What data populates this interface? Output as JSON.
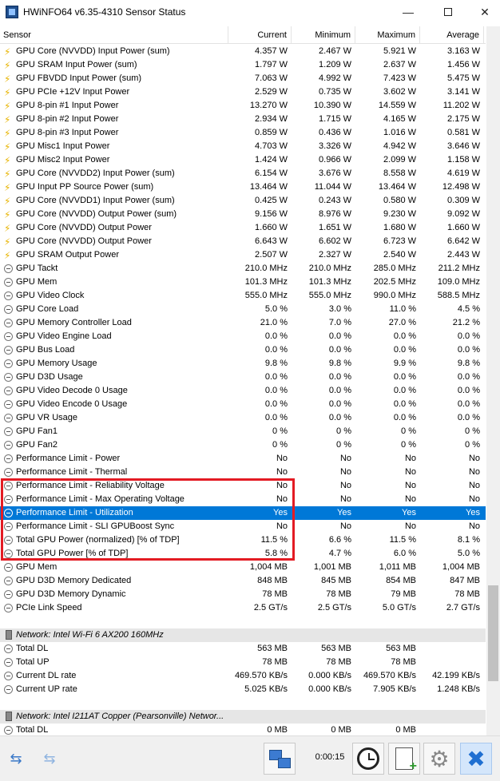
{
  "window": {
    "title": "HWiNFO64 v6.35-4310 Sensor Status",
    "min_glyph": "—",
    "close_glyph": "✕"
  },
  "columns": {
    "sensor": "Sensor",
    "current": "Current",
    "minimum": "Minimum",
    "maximum": "Maximum",
    "average": "Average"
  },
  "rows": [
    {
      "icon": "bolt",
      "name": "GPU Core (NVVDD) Input Power (sum)",
      "cur": "4.357 W",
      "min": "2.467 W",
      "max": "5.921 W",
      "avg": "3.163 W"
    },
    {
      "icon": "bolt",
      "name": "GPU SRAM Input Power (sum)",
      "cur": "1.797 W",
      "min": "1.209 W",
      "max": "2.637 W",
      "avg": "1.456 W"
    },
    {
      "icon": "bolt",
      "name": "GPU FBVDD Input Power (sum)",
      "cur": "7.063 W",
      "min": "4.992 W",
      "max": "7.423 W",
      "avg": "5.475 W"
    },
    {
      "icon": "bolt",
      "name": "GPU PCIe +12V Input Power",
      "cur": "2.529 W",
      "min": "0.735 W",
      "max": "3.602 W",
      "avg": "3.141 W"
    },
    {
      "icon": "bolt",
      "name": "GPU 8-pin #1 Input Power",
      "cur": "13.270 W",
      "min": "10.390 W",
      "max": "14.559 W",
      "avg": "11.202 W"
    },
    {
      "icon": "bolt",
      "name": "GPU 8-pin #2 Input Power",
      "cur": "2.934 W",
      "min": "1.715 W",
      "max": "4.165 W",
      "avg": "2.175 W"
    },
    {
      "icon": "bolt",
      "name": "GPU 8-pin #3 Input Power",
      "cur": "0.859 W",
      "min": "0.436 W",
      "max": "1.016 W",
      "avg": "0.581 W"
    },
    {
      "icon": "bolt",
      "name": "GPU Misc1 Input Power",
      "cur": "4.703 W",
      "min": "3.326 W",
      "max": "4.942 W",
      "avg": "3.646 W"
    },
    {
      "icon": "bolt",
      "name": "GPU Misc2 Input Power",
      "cur": "1.424 W",
      "min": "0.966 W",
      "max": "2.099 W",
      "avg": "1.158 W"
    },
    {
      "icon": "bolt",
      "name": "GPU Core (NVVDD2) Input Power (sum)",
      "cur": "6.154 W",
      "min": "3.676 W",
      "max": "8.558 W",
      "avg": "4.619 W"
    },
    {
      "icon": "bolt",
      "name": "GPU Input PP Source Power (sum)",
      "cur": "13.464 W",
      "min": "11.044 W",
      "max": "13.464 W",
      "avg": "12.498 W"
    },
    {
      "icon": "bolt",
      "name": "GPU Core (NVVDD1) Input Power (sum)",
      "cur": "0.425 W",
      "min": "0.243 W",
      "max": "0.580 W",
      "avg": "0.309 W"
    },
    {
      "icon": "bolt",
      "name": "GPU Core (NVVDD) Output Power (sum)",
      "cur": "9.156 W",
      "min": "8.976 W",
      "max": "9.230 W",
      "avg": "9.092 W"
    },
    {
      "icon": "bolt",
      "name": "GPU Core (NVVDD) Output Power",
      "cur": "1.660 W",
      "min": "1.651 W",
      "max": "1.680 W",
      "avg": "1.660 W"
    },
    {
      "icon": "bolt",
      "name": "GPU Core (NVVDD) Output Power",
      "cur": "6.643 W",
      "min": "6.602 W",
      "max": "6.723 W",
      "avg": "6.642 W"
    },
    {
      "icon": "bolt",
      "name": "GPU SRAM Output Power",
      "cur": "2.507 W",
      "min": "2.327 W",
      "max": "2.540 W",
      "avg": "2.443 W"
    },
    {
      "icon": "gauge",
      "name": "GPU Tackt",
      "cur": "210.0 MHz",
      "min": "210.0 MHz",
      "max": "285.0 MHz",
      "avg": "211.2 MHz"
    },
    {
      "icon": "gauge",
      "name": "GPU Mem",
      "cur": "101.3 MHz",
      "min": "101.3 MHz",
      "max": "202.5 MHz",
      "avg": "109.0 MHz"
    },
    {
      "icon": "gauge",
      "name": "GPU Video Clock",
      "cur": "555.0 MHz",
      "min": "555.0 MHz",
      "max": "990.0 MHz",
      "avg": "588.5 MHz"
    },
    {
      "icon": "gauge",
      "name": "GPU Core Load",
      "cur": "5.0 %",
      "min": "3.0 %",
      "max": "11.0 %",
      "avg": "4.5 %"
    },
    {
      "icon": "gauge",
      "name": "GPU Memory Controller Load",
      "cur": "21.0 %",
      "min": "7.0 %",
      "max": "27.0 %",
      "avg": "21.2 %"
    },
    {
      "icon": "gauge",
      "name": "GPU Video Engine Load",
      "cur": "0.0 %",
      "min": "0.0 %",
      "max": "0.0 %",
      "avg": "0.0 %"
    },
    {
      "icon": "gauge",
      "name": "GPU Bus Load",
      "cur": "0.0 %",
      "min": "0.0 %",
      "max": "0.0 %",
      "avg": "0.0 %"
    },
    {
      "icon": "gauge",
      "name": "GPU Memory Usage",
      "cur": "9.8 %",
      "min": "9.8 %",
      "max": "9.9 %",
      "avg": "9.8 %"
    },
    {
      "icon": "gauge",
      "name": "GPU D3D Usage",
      "cur": "0.0 %",
      "min": "0.0 %",
      "max": "0.0 %",
      "avg": "0.0 %"
    },
    {
      "icon": "gauge",
      "name": "GPU Video Decode 0 Usage",
      "cur": "0.0 %",
      "min": "0.0 %",
      "max": "0.0 %",
      "avg": "0.0 %"
    },
    {
      "icon": "gauge",
      "name": "GPU Video Encode 0 Usage",
      "cur": "0.0 %",
      "min": "0.0 %",
      "max": "0.0 %",
      "avg": "0.0 %"
    },
    {
      "icon": "gauge",
      "name": "GPU VR Usage",
      "cur": "0.0 %",
      "min": "0.0 %",
      "max": "0.0 %",
      "avg": "0.0 %"
    },
    {
      "icon": "gauge",
      "name": "GPU Fan1",
      "cur": "0 %",
      "min": "0 %",
      "max": "0 %",
      "avg": "0 %"
    },
    {
      "icon": "gauge",
      "name": "GPU Fan2",
      "cur": "0 %",
      "min": "0 %",
      "max": "0 %",
      "avg": "0 %"
    },
    {
      "icon": "gauge",
      "name": "Performance Limit - Power",
      "cur": "No",
      "min": "No",
      "max": "No",
      "avg": "No"
    },
    {
      "icon": "gauge",
      "name": "Performance Limit - Thermal",
      "cur": "No",
      "min": "No",
      "max": "No",
      "avg": "No"
    },
    {
      "icon": "gauge",
      "name": "Performance Limit - Reliability Voltage",
      "cur": "No",
      "min": "No",
      "max": "No",
      "avg": "No"
    },
    {
      "icon": "gauge",
      "name": "Performance Limit - Max Operating Voltage",
      "cur": "No",
      "min": "No",
      "max": "No",
      "avg": "No"
    },
    {
      "icon": "gauge",
      "name": "Performance Limit - Utilization",
      "cur": "Yes",
      "min": "Yes",
      "max": "Yes",
      "avg": "Yes",
      "selected": true
    },
    {
      "icon": "gauge",
      "name": "Performance Limit - SLI GPUBoost Sync",
      "cur": "No",
      "min": "No",
      "max": "No",
      "avg": "No"
    },
    {
      "icon": "gauge",
      "name": "Total GPU Power (normalized) [% of TDP]",
      "cur": "11.5 %",
      "min": "6.6 %",
      "max": "11.5 %",
      "avg": "8.1 %"
    },
    {
      "icon": "gauge",
      "name": "Total GPU Power [% of TDP]",
      "cur": "5.8 %",
      "min": "4.7 %",
      "max": "6.0 %",
      "avg": "5.0 %"
    },
    {
      "icon": "gauge",
      "name": "GPU Mem",
      "cur": "1,004 MB",
      "min": "1,001 MB",
      "max": "1,011 MB",
      "avg": "1,004 MB"
    },
    {
      "icon": "gauge",
      "name": "GPU D3D Memory Dedicated",
      "cur": "848 MB",
      "min": "845 MB",
      "max": "854 MB",
      "avg": "847 MB"
    },
    {
      "icon": "gauge",
      "name": "GPU D3D Memory Dynamic",
      "cur": "78 MB",
      "min": "78 MB",
      "max": "79 MB",
      "avg": "78 MB"
    },
    {
      "icon": "gauge",
      "name": "PCIe Link Speed",
      "cur": "2.5 GT/s",
      "min": "2.5 GT/s",
      "max": "5.0 GT/s",
      "avg": "2.7 GT/s"
    },
    {
      "type": "blank"
    },
    {
      "type": "section",
      "icon": "chip",
      "name": "Network: Intel Wi-Fi 6 AX200 160MHz"
    },
    {
      "icon": "gauge",
      "name": "Total DL",
      "cur": "563 MB",
      "min": "563 MB",
      "max": "563 MB",
      "avg": ""
    },
    {
      "icon": "gauge",
      "name": "Total UP",
      "cur": "78 MB",
      "min": "78 MB",
      "max": "78 MB",
      "avg": ""
    },
    {
      "icon": "gauge",
      "name": "Current DL rate",
      "cur": "469.570 KB/s",
      "min": "0.000 KB/s",
      "max": "469.570 KB/s",
      "avg": "42.199 KB/s"
    },
    {
      "icon": "gauge",
      "name": "Current UP rate",
      "cur": "5.025 KB/s",
      "min": "0.000 KB/s",
      "max": "7.905 KB/s",
      "avg": "1.248 KB/s"
    },
    {
      "type": "blank"
    },
    {
      "type": "section",
      "icon": "chip",
      "name": "Network: Intel I211AT Copper (Pearsonville) Networ..."
    },
    {
      "icon": "gauge",
      "name": "Total DL",
      "cur": "0 MB",
      "min": "0 MB",
      "max": "0 MB",
      "avg": ""
    }
  ],
  "toolbar": {
    "timer": "0:00:15",
    "nav_back_glyph": "⇆",
    "nav_fwd_glyph": "⇆",
    "gear_glyph": "⚙",
    "close_glyph": "✖"
  },
  "colors": {
    "selection": "#0078d7",
    "highlight_box": "#e31b23",
    "power_icon": "#e8b400"
  }
}
